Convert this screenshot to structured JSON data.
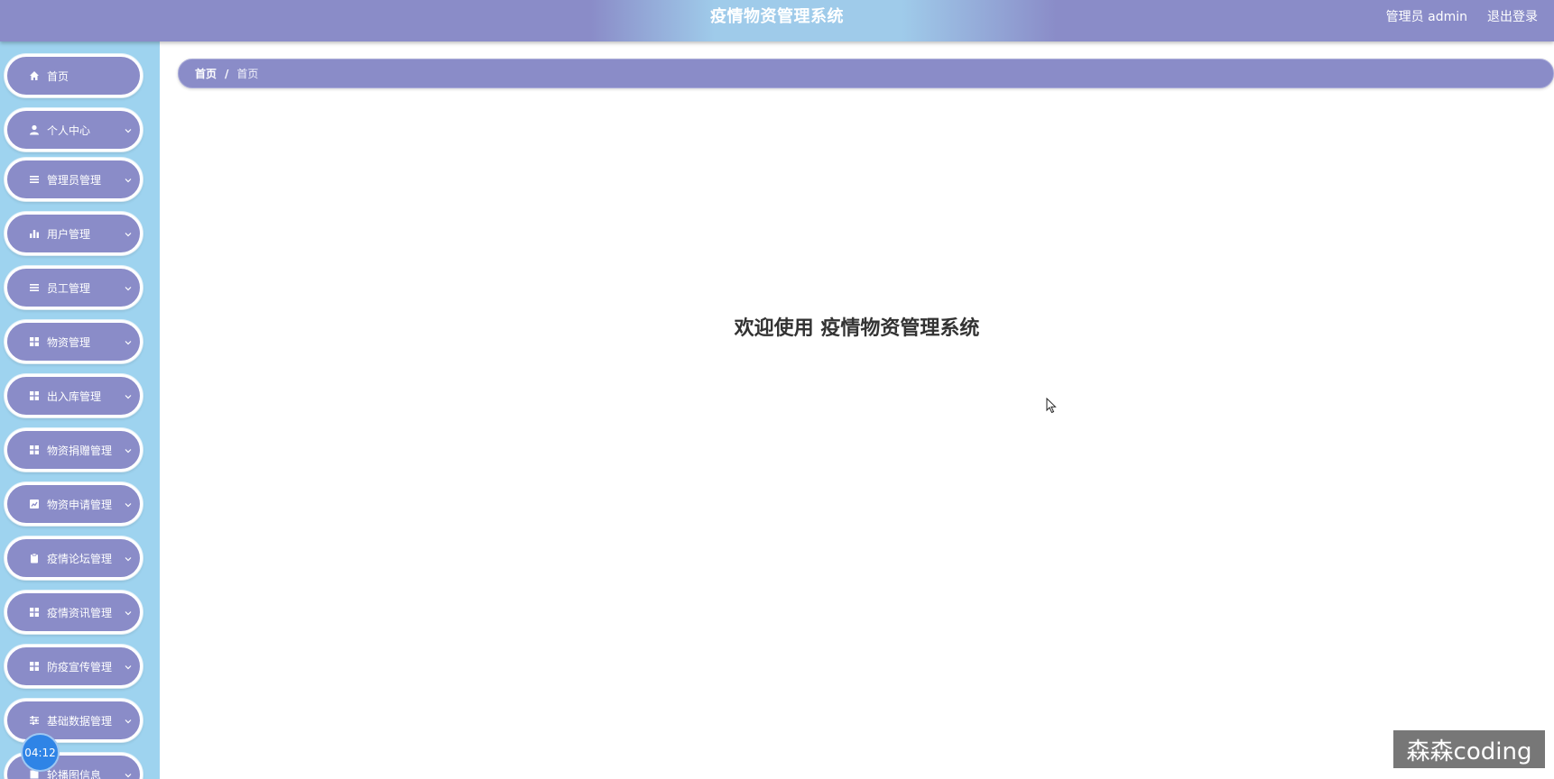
{
  "header": {
    "title": "疫情物资管理系统",
    "user_label": "管理员 admin",
    "logout": "退出登录"
  },
  "sidebar": {
    "items": [
      {
        "label": "首页",
        "icon": "home-icon",
        "has_arrow": false
      },
      {
        "label": "个人中心",
        "icon": "user-icon",
        "has_arrow": true
      },
      {
        "label": "管理员管理",
        "icon": "list-icon",
        "has_arrow": true
      },
      {
        "label": "用户管理",
        "icon": "bar-chart-icon",
        "has_arrow": true
      },
      {
        "label": "员工管理",
        "icon": "list-icon",
        "has_arrow": true
      },
      {
        "label": "物资管理",
        "icon": "grid-icon",
        "has_arrow": true
      },
      {
        "label": "出入库管理",
        "icon": "grid-icon",
        "has_arrow": true
      },
      {
        "label": "物资捐赠管理",
        "icon": "grid-icon",
        "has_arrow": true
      },
      {
        "label": "物资申请管理",
        "icon": "chart-square-icon",
        "has_arrow": true
      },
      {
        "label": "疫情论坛管理",
        "icon": "clipboard-icon",
        "has_arrow": true
      },
      {
        "label": "疫情资讯管理",
        "icon": "grid-icon",
        "has_arrow": true
      },
      {
        "label": "防疫宣传管理",
        "icon": "grid-icon",
        "has_arrow": true
      },
      {
        "label": "基础数据管理",
        "icon": "sliders-icon",
        "has_arrow": true
      },
      {
        "label": "轮播图信息",
        "icon": "square-icon",
        "has_arrow": true
      }
    ]
  },
  "breadcrumb": {
    "home": "首页",
    "separator": "/",
    "current": "首页"
  },
  "main": {
    "welcome": "欢迎使用 疫情物资管理系统"
  },
  "overlay": {
    "timer": "04:12",
    "watermark": "森森coding"
  },
  "colors": {
    "primary": "#8a8cc8",
    "sidebar_bg": "#9ed3ef",
    "header_highlight": "#9fcbea"
  }
}
